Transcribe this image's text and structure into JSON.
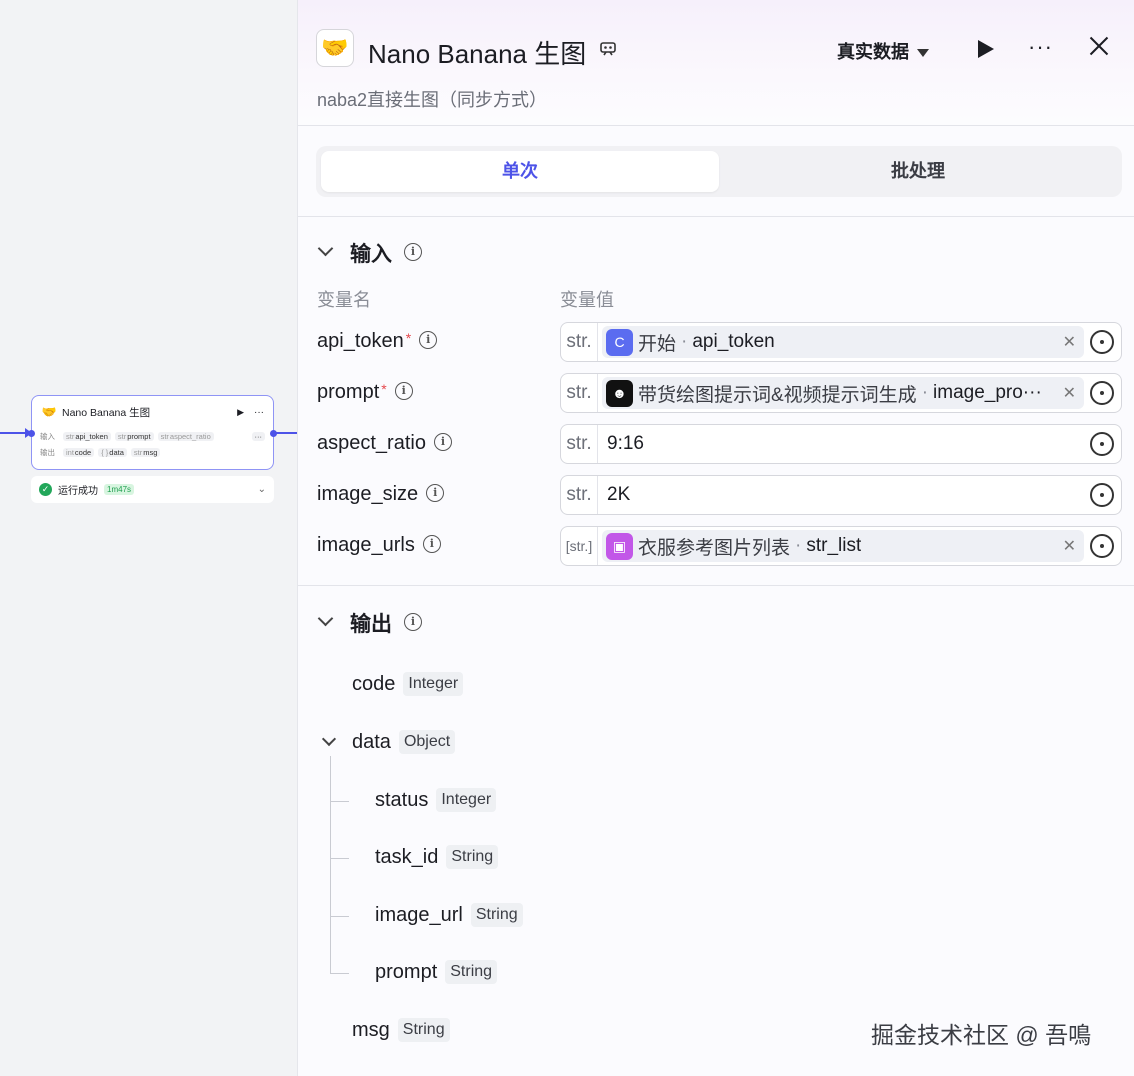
{
  "canvas": {
    "node": {
      "title": "Nano Banana 生图",
      "title_icon": "🤝",
      "input_label": "输入",
      "output_label": "输出",
      "inputs": [
        {
          "type": "str",
          "name": "api_token"
        },
        {
          "type": "str",
          "name": "prompt"
        },
        {
          "type": "str",
          "name": "aspect_ratio"
        }
      ],
      "outputs": [
        {
          "type": "int",
          "name": "code"
        },
        {
          "type": "{ }",
          "name": "data"
        },
        {
          "type": "str",
          "name": "msg"
        }
      ],
      "more_inputs": "···",
      "status_text": "运行成功",
      "duration": "1m47s"
    }
  },
  "panel": {
    "icon": "🤝",
    "title": "Nano Banana 生图",
    "description": "naba2直接生图（同步方式）",
    "data_selector": "真实数据",
    "more": "···",
    "tabs": [
      {
        "label": "单次",
        "active": true
      },
      {
        "label": "批处理",
        "active": false
      }
    ],
    "input": {
      "label": "输入",
      "col_name": "变量名",
      "col_value": "变量值",
      "rows": [
        {
          "name": "api_token",
          "required": true,
          "type": "str.",
          "kind": "ref",
          "badge": "C",
          "badge_color": "#5b6cf0",
          "source": "开始",
          "var": "api_token"
        },
        {
          "name": "prompt",
          "required": true,
          "type": "str.",
          "kind": "ref",
          "badge": "☻",
          "badge_color": "#111111",
          "source": "带货绘图提示词&视频提示词生成",
          "var": "image_pro···"
        },
        {
          "name": "aspect_ratio",
          "required": false,
          "type": "str.",
          "kind": "const",
          "value": "9:16"
        },
        {
          "name": "image_size",
          "required": false,
          "type": "str.",
          "kind": "const",
          "value": "2K"
        },
        {
          "name": "image_urls",
          "required": false,
          "type": "[str.]",
          "kind": "ref",
          "badge": "▣",
          "badge_color": "#c257e8",
          "source": "衣服参考图片列表",
          "var": "str_list"
        }
      ]
    },
    "output": {
      "label": "输出",
      "items": [
        {
          "name": "code",
          "type": "Integer"
        },
        {
          "name": "data",
          "type": "Object",
          "children": [
            {
              "name": "status",
              "type": "Integer"
            },
            {
              "name": "task_id",
              "type": "String"
            },
            {
              "name": "image_url",
              "type": "String"
            },
            {
              "name": "prompt",
              "type": "String"
            }
          ]
        },
        {
          "name": "msg",
          "type": "String"
        }
      ]
    }
  },
  "watermark": "掘金技术社区 @ 吾鳴"
}
